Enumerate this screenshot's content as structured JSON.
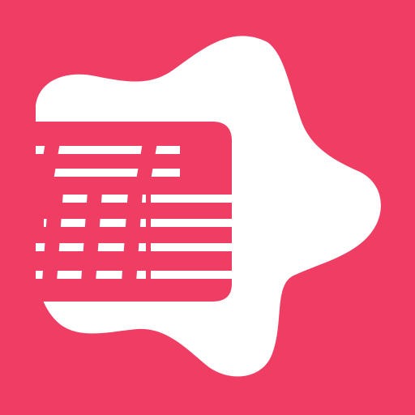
{
  "icon": {
    "name": "news-reader-app-icon",
    "background_color": "#ef3d63",
    "shape_color": "#ffffff",
    "glyph_color": "#ef3d63",
    "shape": "rounded-star-blob",
    "glyph": "newspaper-with-text-lines"
  }
}
